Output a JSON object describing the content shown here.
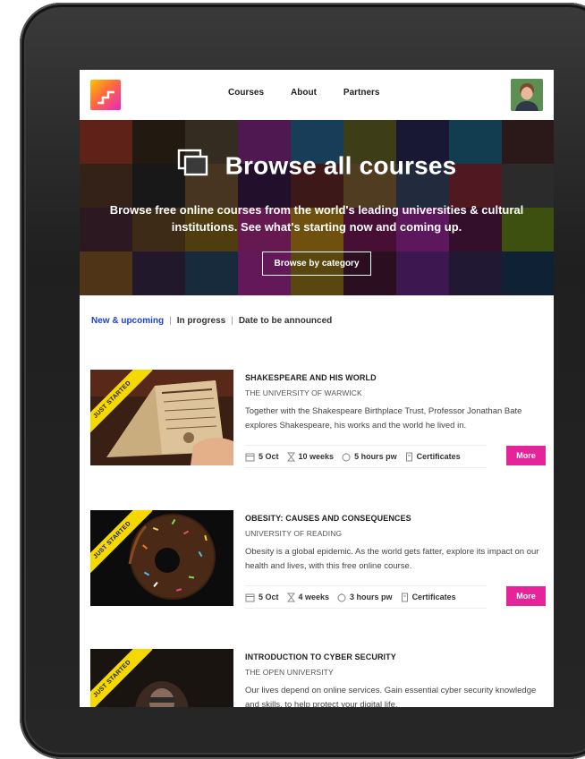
{
  "header": {
    "nav": [
      "Courses",
      "About",
      "Partners"
    ]
  },
  "hero": {
    "icon": "browse-icon",
    "title": "Browse all courses",
    "subtitle": "Browse free online courses from the world's leading universities & cultural institutions. See what's starting now and coming up.",
    "button_label": "Browse by category"
  },
  "tabs": {
    "items": [
      "New & upcoming",
      "In progress",
      "Date to be announced"
    ],
    "active": "New & upcoming"
  },
  "courses": [
    {
      "ribbon": "JUST STARTED",
      "title": "SHAKESPEARE AND HIS WORLD",
      "university": "THE UNIVERSITY OF WARWICK",
      "description": "Together with the Shakespeare Birthplace Trust, Professor Jonathan Bate explores Shakespeare, his works and the world he lived in.",
      "start": "5 Oct",
      "duration": "10 weeks",
      "effort": "5 hours pw",
      "certificates": "Certificates",
      "more": "More"
    },
    {
      "ribbon": "JUST STARTED",
      "title": "OBESITY: CAUSES AND CONSEQUENCES",
      "university": "UNIVERSITY OF READING",
      "description": "Obesity is a global epidemic. As the world gets fatter, explore its impact on our health and lives, with this free online course.",
      "start": "5 Oct",
      "duration": "4 weeks",
      "effort": "3 hours pw",
      "certificates": "Certificates",
      "more": "More"
    },
    {
      "ribbon": "JUST STARTED",
      "title": "INTRODUCTION TO CYBER SECURITY",
      "university": "THE OPEN UNIVERSITY",
      "description": "Our lives depend on online services. Gain essential cyber security knowledge and skills, to help protect your digital life."
    }
  ],
  "colors": {
    "accent": "#e6249a",
    "tab_active": "#1c3fd8",
    "ribbon": "#f5d800"
  }
}
